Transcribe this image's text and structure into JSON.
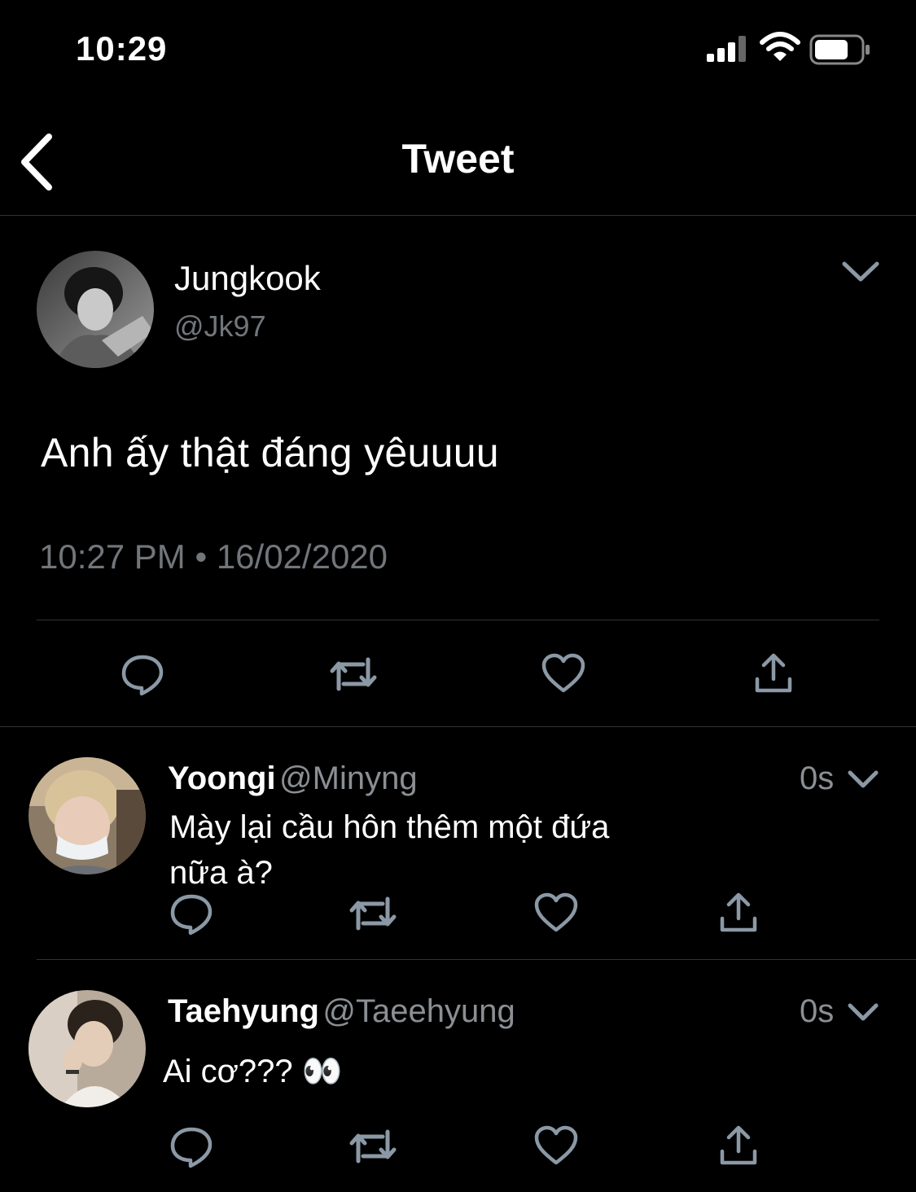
{
  "status_bar": {
    "time": "10:29"
  },
  "header": {
    "title": "Tweet"
  },
  "tweet": {
    "author_name": "Jungkook",
    "author_handle": "@Jk97",
    "text": "Anh ấy thật đáng yêuuuu",
    "timestamp": "10:27 PM • 16/02/2020"
  },
  "replies": [
    {
      "name": "Yoongi",
      "handle": "@Minyng",
      "time": "0s",
      "text_line1": "Mày lại cầu hôn thêm một đứa",
      "text_line2": "nữa à?"
    },
    {
      "name": "Taehyung",
      "handle": "@Taeehyung",
      "time": "0s",
      "text_line1": "Ai cơ??? 👀"
    }
  ],
  "icons": {
    "back": "chevron-left-icon",
    "more": "chevron-down-icon",
    "reply": "reply-icon",
    "retweet": "retweet-icon",
    "like": "heart-icon",
    "share": "share-icon"
  },
  "colors": {
    "background": "#000000",
    "text": "#ffffff",
    "secondary": "#71767b",
    "divider": "#2f3336",
    "icon": "#8b98a5"
  }
}
